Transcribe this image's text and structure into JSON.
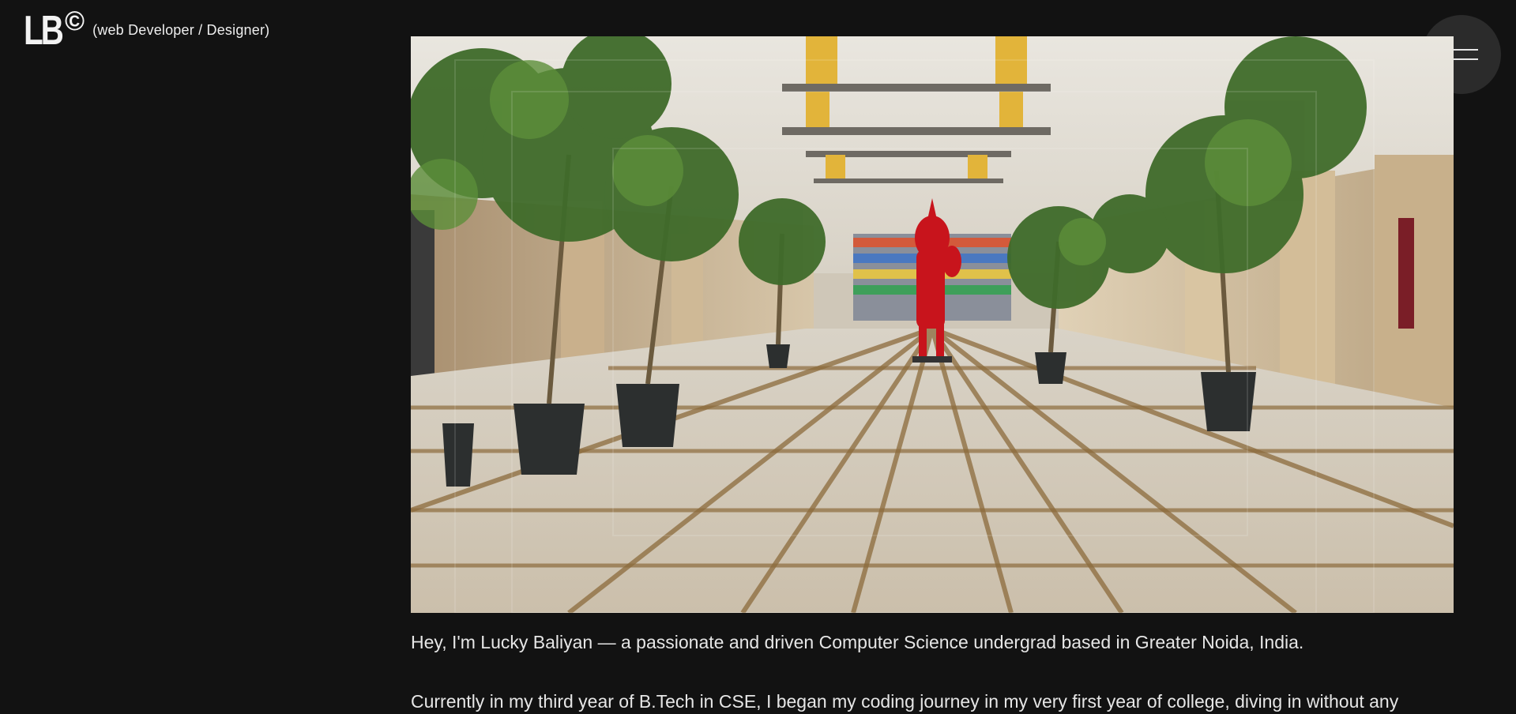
{
  "header": {
    "logo_text": "LB",
    "logo_mark": "©",
    "role": "(web Developer / Designer)"
  },
  "menu": {
    "icon": "hamburger-icon"
  },
  "hero": {
    "description_icon": "hallway-photo"
  },
  "about": {
    "intro": "Hey, I'm Lucky Baliyan — a passionate and driven Computer Science undergrad based in Greater Noida, India.",
    "journey": "Currently in my third year of B.Tech in CSE, I began my coding journey in my very first year of college, diving in without any"
  },
  "colors": {
    "background": "#121212",
    "text": "#e6e6e6",
    "menu_bg": "#2b2b2b",
    "statue": "#c8141c"
  }
}
